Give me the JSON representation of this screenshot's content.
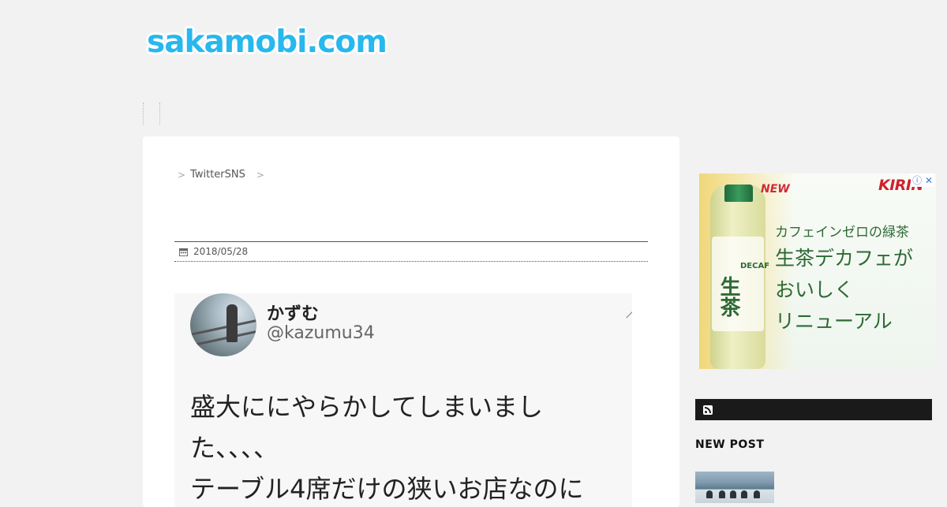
{
  "site": {
    "logo_text": "sakamobi.com"
  },
  "breadcrumb": {
    "separator": ">",
    "category": "TwitterSNS"
  },
  "post": {
    "date": "2018/05/28"
  },
  "tweet": {
    "name": "かずむ",
    "handle": "@kazumu34",
    "lines": [
      "盛大ににやらかしてしまいまし",
      "た、、、、",
      "テーブル4席だけの狭いお店なのに"
    ]
  },
  "ad": {
    "new_label": "NEW",
    "brand": "KIRIN",
    "adchoices": "ⓘ ✕",
    "product_vertical": "生茶",
    "decaf_label": "DECAF",
    "copy_line1": "カフェインゼロの緑茶",
    "copy_line2": "生茶デカフェが",
    "copy_line3": "おいしく",
    "copy_line4": "リニューアル"
  },
  "sidebar": {
    "new_post_heading": "NEW POST"
  },
  "colors": {
    "logo": "#27b8ef",
    "rss_bar": "#1a1a1a",
    "kirin_red": "#d0202c"
  }
}
